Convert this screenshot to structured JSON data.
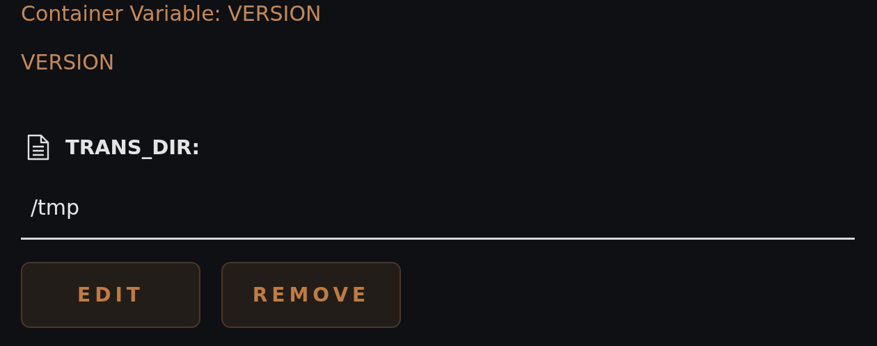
{
  "description": "Container Variable: VERSION",
  "subtitle": "VERSION",
  "variable": {
    "label": "TRANS_DIR:",
    "value": "/tmp"
  },
  "buttons": [
    {
      "label": "EDIT"
    },
    {
      "label": "REMOVE"
    }
  ]
}
